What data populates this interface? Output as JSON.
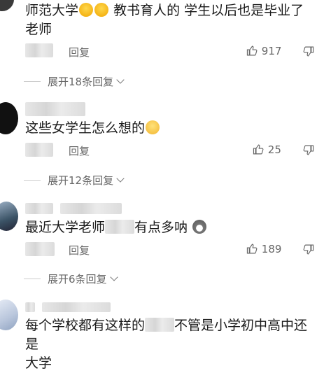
{
  "comments": [
    {
      "text_line1": "师范大学",
      "text_line1b": "教书育人的  学生以后也是毕业了",
      "text_line2": "老师",
      "reply_label": "回复",
      "likes": "917",
      "expand_label": "展开18条回复"
    },
    {
      "text": "这些女学生怎么想的",
      "reply_label": "回复",
      "likes": "25",
      "expand_label": "展开12条回复"
    },
    {
      "text_a": "最近大学老师",
      "text_b": "有点多呐",
      "reply_label": "回复",
      "likes": "189",
      "expand_label": "展开6条回复"
    },
    {
      "text_a": "每个学校都有这样的",
      "text_b": "不管是小学初中高中还是",
      "text_line2": "大学"
    }
  ],
  "colors": {
    "text": "#1a1a1a",
    "muted": "#666666",
    "divider": "#cccccc"
  }
}
